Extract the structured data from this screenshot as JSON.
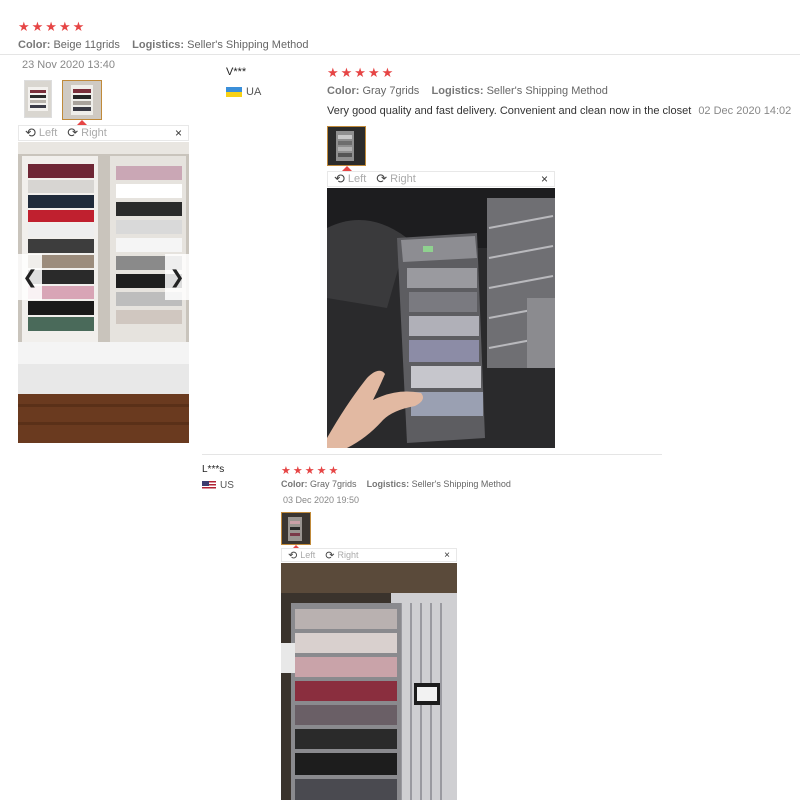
{
  "review1": {
    "stars": "★★★★★",
    "color_label": "Color:",
    "color_value": "Beige 11grids",
    "logistics_label": "Logistics:",
    "logistics_value": "Seller's Shipping Method",
    "date": "23 Nov 2020 13:40",
    "viewer": {
      "left": "Left",
      "right": "Right",
      "close": "×"
    },
    "prev_glyph": "❮",
    "next_glyph": "❯"
  },
  "review2": {
    "name": "V***",
    "country": "UA",
    "stars": "★★★★★",
    "color_label": "Color:",
    "color_value": "Gray 7grids",
    "logistics_label": "Logistics:",
    "logistics_value": "Seller's Shipping Method",
    "text": "Very good quality and fast delivery. Convenient and clean now in the closet",
    "date": "02 Dec 2020 14:02",
    "viewer": {
      "left": "Left",
      "right": "Right",
      "close": "×"
    }
  },
  "review3": {
    "name": "L***s",
    "country": "US",
    "stars": "★★★★★",
    "color_label": "Color:",
    "color_value": "Gray 7grids",
    "logistics_label": "Logistics:",
    "logistics_value": "Seller's Shipping Method",
    "date": "03 Dec 2020 19:50",
    "viewer": {
      "left": "Left",
      "right": "Right",
      "close": "×"
    }
  },
  "icons": {
    "rotate_left": "⟲",
    "rotate_right": "⟳"
  },
  "colors": {
    "star": "#e64545",
    "active_thumb_border": "#c08a3a"
  }
}
